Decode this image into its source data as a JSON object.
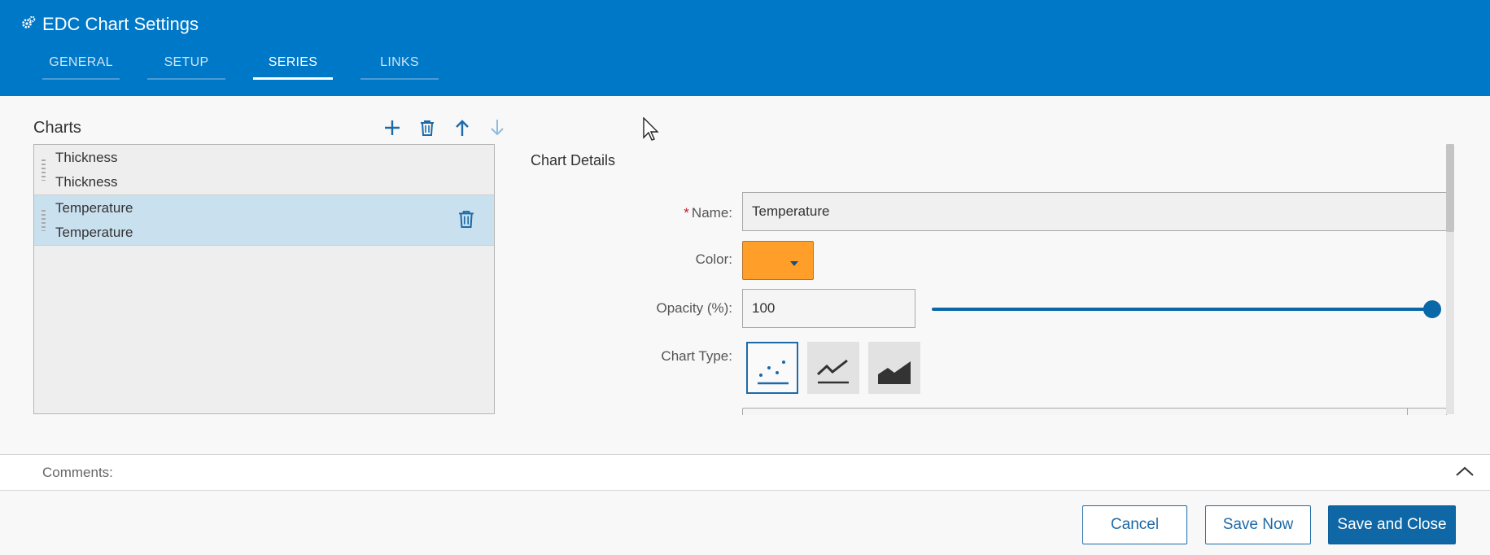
{
  "window": {
    "title": "EDC Chart Settings",
    "icon": "gear-icon"
  },
  "tabs": [
    {
      "label": "GENERAL",
      "active": false
    },
    {
      "label": "SETUP",
      "active": false
    },
    {
      "label": "SERIES",
      "active": true
    },
    {
      "label": "LINKS",
      "active": false
    }
  ],
  "charts_panel": {
    "title": "Charts",
    "toolbar": [
      "plus-icon",
      "trash-icon",
      "arrow-up-icon",
      "arrow-down-icon"
    ],
    "items": [
      {
        "line1": "Thickness",
        "line2": "Thickness",
        "selected": false
      },
      {
        "line1": "Temperature",
        "line2": "Temperature",
        "selected": true
      }
    ]
  },
  "details": {
    "title": "Chart Details",
    "name_label": "Name:",
    "name_required": "*",
    "name_value": "Temperature",
    "color_label": "Color:",
    "color_value": "#ff9f2a",
    "opacity_label": "Opacity (%):",
    "opacity_value": "100",
    "opacity_slider_percent": 100,
    "chart_type_label": "Chart Type:",
    "chart_types": [
      "scatter-chart-icon",
      "line-chart-icon",
      "area-chart-icon"
    ],
    "chart_type_selected": "scatter-chart-icon"
  },
  "comments": {
    "label": "Comments:"
  },
  "footer": {
    "cancel": "Cancel",
    "save_now": "Save Now",
    "save_close": "Save and Close"
  },
  "colors": {
    "header": "#0078c8",
    "accent": "#1d6aa8",
    "selected_row": "#c9e0ef"
  }
}
